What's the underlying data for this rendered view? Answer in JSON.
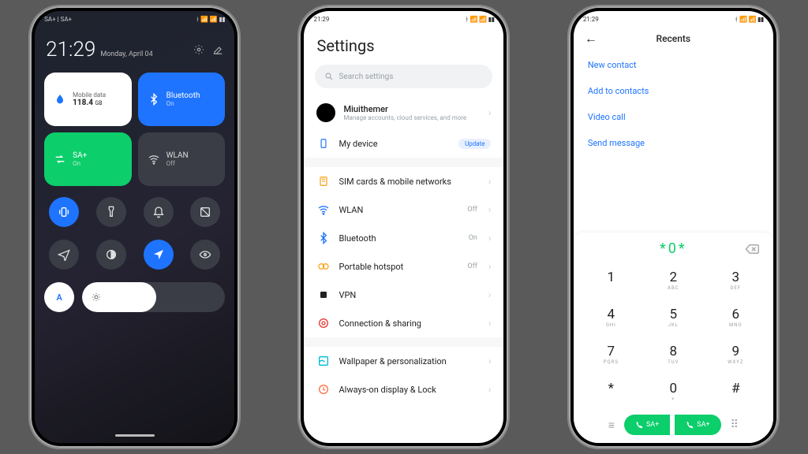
{
  "status": {
    "time": "21:29",
    "carrierDual": "SA+ | SA+"
  },
  "cc": {
    "time": "21:29",
    "date": "Monday, April 04",
    "tiles": {
      "data": {
        "label": "Mobile data",
        "value": "118.4",
        "unit": "GB"
      },
      "bt": {
        "label": "Bluetooth",
        "state": "On"
      },
      "sim": {
        "label": "SA+",
        "state": "On"
      },
      "wlan": {
        "label": "WLAN",
        "state": "Off"
      }
    },
    "auto_label": "A"
  },
  "settings": {
    "title": "Settings",
    "search_ph": "Search settings",
    "account": {
      "name": "Miuithemer",
      "sub": "Manage accounts, cloud services, and more"
    },
    "device": {
      "label": "My device",
      "badge": "Update"
    },
    "items": [
      {
        "label": "SIM cards & mobile networks",
        "val": ""
      },
      {
        "label": "WLAN",
        "val": "Off"
      },
      {
        "label": "Bluetooth",
        "val": "On"
      },
      {
        "label": "Portable hotspot",
        "val": "Off"
      },
      {
        "label": "VPN",
        "val": ""
      },
      {
        "label": "Connection & sharing",
        "val": ""
      }
    ],
    "items2": [
      {
        "label": "Wallpaper & personalization"
      },
      {
        "label": "Always-on display & Lock"
      }
    ]
  },
  "dialer": {
    "title": "Recents",
    "menu": [
      "New contact",
      "Add to contacts",
      "Video call",
      "Send message"
    ],
    "input": "*0*",
    "keys": [
      {
        "d": "1",
        "l": ""
      },
      {
        "d": "2",
        "l": "ABC"
      },
      {
        "d": "3",
        "l": "DEF"
      },
      {
        "d": "4",
        "l": "GHI"
      },
      {
        "d": "5",
        "l": "JKL"
      },
      {
        "d": "6",
        "l": "MNO"
      },
      {
        "d": "7",
        "l": "PQRS"
      },
      {
        "d": "8",
        "l": "TUV"
      },
      {
        "d": "9",
        "l": "WXYZ"
      },
      {
        "d": "*",
        "l": ""
      },
      {
        "d": "0",
        "l": "+"
      },
      {
        "d": "#",
        "l": ""
      }
    ],
    "call_sim1": "SA+",
    "call_sim2": "SA+"
  }
}
